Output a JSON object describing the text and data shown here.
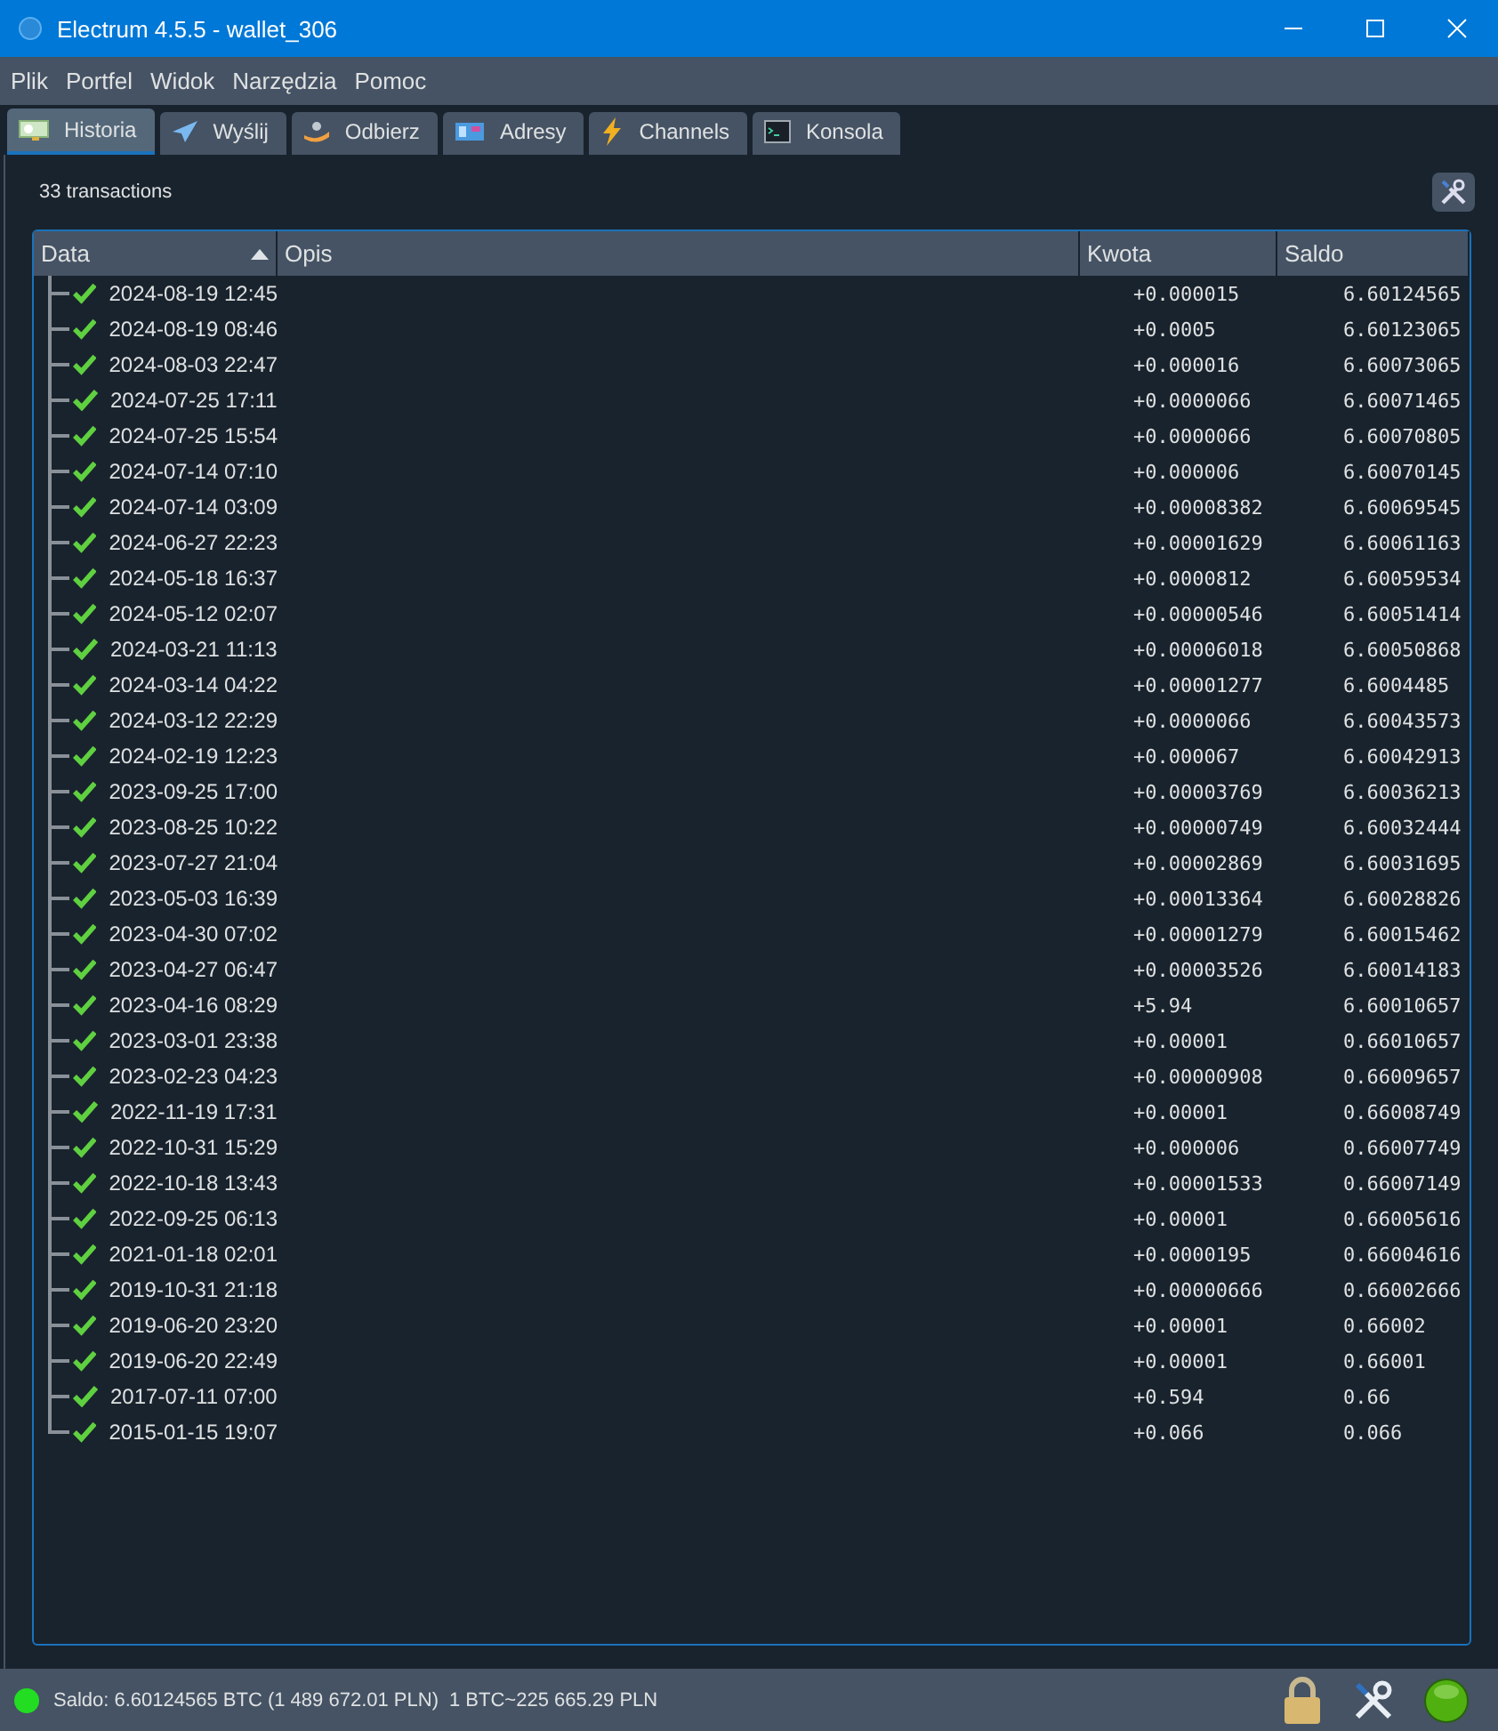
{
  "window": {
    "title": "Electrum 4.5.5  -  wallet_306"
  },
  "menu": [
    "Plik",
    "Portfel",
    "Widok",
    "Narzędzia",
    "Pomoc"
  ],
  "tabs": [
    {
      "label": "Historia",
      "selected": true
    },
    {
      "label": "Wyślij",
      "selected": false
    },
    {
      "label": "Odbierz",
      "selected": false
    },
    {
      "label": "Adresy",
      "selected": false
    },
    {
      "label": "Channels",
      "selected": false
    },
    {
      "label": "Konsola",
      "selected": false
    }
  ],
  "summary": "33 transactions",
  "table": {
    "columns": [
      {
        "label": "Data",
        "sorted": true
      },
      {
        "label": "Opis",
        "sorted": false
      },
      {
        "label": "Kwota",
        "sorted": false
      },
      {
        "label": "Saldo",
        "sorted": false
      }
    ],
    "rows": [
      {
        "date": "2024-08-19 12:45",
        "amount": "+0.000015",
        "balance": "6.60124565"
      },
      {
        "date": "2024-08-19 08:46",
        "amount": "+0.0005",
        "balance": "6.60123065"
      },
      {
        "date": "2024-08-03 22:47",
        "amount": "+0.000016",
        "balance": "6.60073065"
      },
      {
        "date": "2024-07-25 17:11",
        "amount": "+0.0000066",
        "balance": "6.60071465"
      },
      {
        "date": "2024-07-25 15:54",
        "amount": "+0.0000066",
        "balance": "6.60070805"
      },
      {
        "date": "2024-07-14 07:10",
        "amount": "+0.000006",
        "balance": "6.60070145"
      },
      {
        "date": "2024-07-14 03:09",
        "amount": "+0.00008382",
        "balance": "6.60069545"
      },
      {
        "date": "2024-06-27 22:23",
        "amount": "+0.00001629",
        "balance": "6.60061163"
      },
      {
        "date": "2024-05-18 16:37",
        "amount": "+0.0000812",
        "balance": "6.60059534"
      },
      {
        "date": "2024-05-12 02:07",
        "amount": "+0.00000546",
        "balance": "6.60051414"
      },
      {
        "date": "2024-03-21 11:13",
        "amount": "+0.00006018",
        "balance": "6.60050868"
      },
      {
        "date": "2024-03-14 04:22",
        "amount": "+0.00001277",
        "balance": "6.6004485"
      },
      {
        "date": "2024-03-12 22:29",
        "amount": "+0.0000066",
        "balance": "6.60043573"
      },
      {
        "date": "2024-02-19 12:23",
        "amount": "+0.000067",
        "balance": "6.60042913"
      },
      {
        "date": "2023-09-25 17:00",
        "amount": "+0.00003769",
        "balance": "6.60036213"
      },
      {
        "date": "2023-08-25 10:22",
        "amount": "+0.00000749",
        "balance": "6.60032444"
      },
      {
        "date": "2023-07-27 21:04",
        "amount": "+0.00002869",
        "balance": "6.60031695"
      },
      {
        "date": "2023-05-03 16:39",
        "amount": "+0.00013364",
        "balance": "6.60028826"
      },
      {
        "date": "2023-04-30 07:02",
        "amount": "+0.00001279",
        "balance": "6.60015462"
      },
      {
        "date": "2023-04-27 06:47",
        "amount": "+0.00003526",
        "balance": "6.60014183"
      },
      {
        "date": "2023-04-16 08:29",
        "amount": "+5.94",
        "balance": "6.60010657"
      },
      {
        "date": "2023-03-01 23:38",
        "amount": "+0.00001",
        "balance": "0.66010657"
      },
      {
        "date": "2023-02-23 04:23",
        "amount": "+0.00000908",
        "balance": "0.66009657"
      },
      {
        "date": "2022-11-19 17:31",
        "amount": "+0.00001",
        "balance": "0.66008749"
      },
      {
        "date": "2022-10-31 15:29",
        "amount": "+0.000006",
        "balance": "0.66007749"
      },
      {
        "date": "2022-10-18 13:43",
        "amount": "+0.00001533",
        "balance": "0.66007149"
      },
      {
        "date": "2022-09-25 06:13",
        "amount": "+0.00001",
        "balance": "0.66005616"
      },
      {
        "date": "2021-01-18 02:01",
        "amount": "+0.0000195",
        "balance": "0.66004616"
      },
      {
        "date": "2019-10-31 21:18",
        "amount": "+0.00000666",
        "balance": "0.66002666"
      },
      {
        "date": "2019-06-20 23:20",
        "amount": "+0.00001",
        "balance": "0.66002"
      },
      {
        "date": "2019-06-20 22:49",
        "amount": "+0.00001",
        "balance": "0.66001"
      },
      {
        "date": "2017-07-11 07:00",
        "amount": "+0.594",
        "balance": "0.66"
      },
      {
        "date": "2015-01-15 19:07",
        "amount": "+0.066",
        "balance": "0.066"
      }
    ]
  },
  "status_bar": {
    "connected": true,
    "balance": "Saldo: 6.60124565 BTC (1 489 672.01 PLN)",
    "rate": "1 BTC~225 665.29 PLN"
  }
}
